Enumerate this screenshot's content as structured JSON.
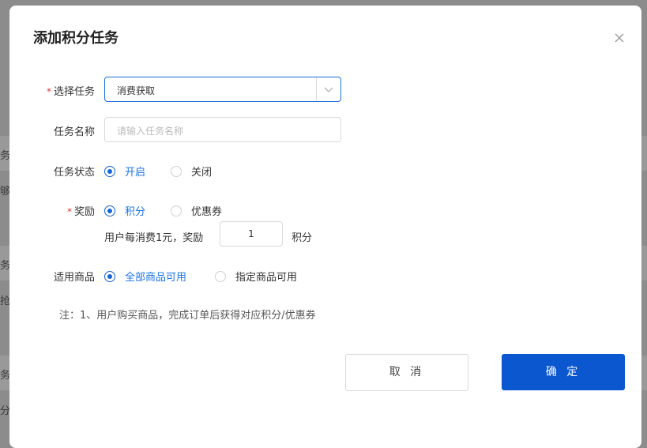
{
  "background": {
    "fragments": [
      "务",
      "够",
      "务",
      "抢",
      "务",
      "分享"
    ]
  },
  "dialog": {
    "title": "添加积分任务",
    "close_icon": "close-icon",
    "fields": {
      "task_select": {
        "required_mark": "*",
        "label": "选择任务",
        "value": "消费获取"
      },
      "task_name": {
        "label": "任务名称",
        "placeholder": "请输入任务名称"
      },
      "task_status": {
        "label": "任务状态",
        "options": [
          "开启",
          "关闭"
        ],
        "selected": "开启"
      },
      "reward": {
        "required_mark": "*",
        "label": "奖励",
        "options": [
          "积分",
          "优惠券"
        ],
        "selected": "积分",
        "rule_prefix": "用户每消费1元，奖励",
        "amount": "1",
        "unit": "积分"
      },
      "goods": {
        "label": "适用商品",
        "options": [
          "全部商品可用",
          "指定商品可用"
        ],
        "selected": "全部商品可用"
      }
    },
    "note": "注：1、用户购买商品，完成订单后获得对应积分/优惠券",
    "buttons": {
      "cancel": "取 消",
      "confirm": "确 定"
    },
    "colors": {
      "primary": "#0b57d0",
      "required": "#e4393c",
      "selected_text": "#1a73e8"
    }
  }
}
